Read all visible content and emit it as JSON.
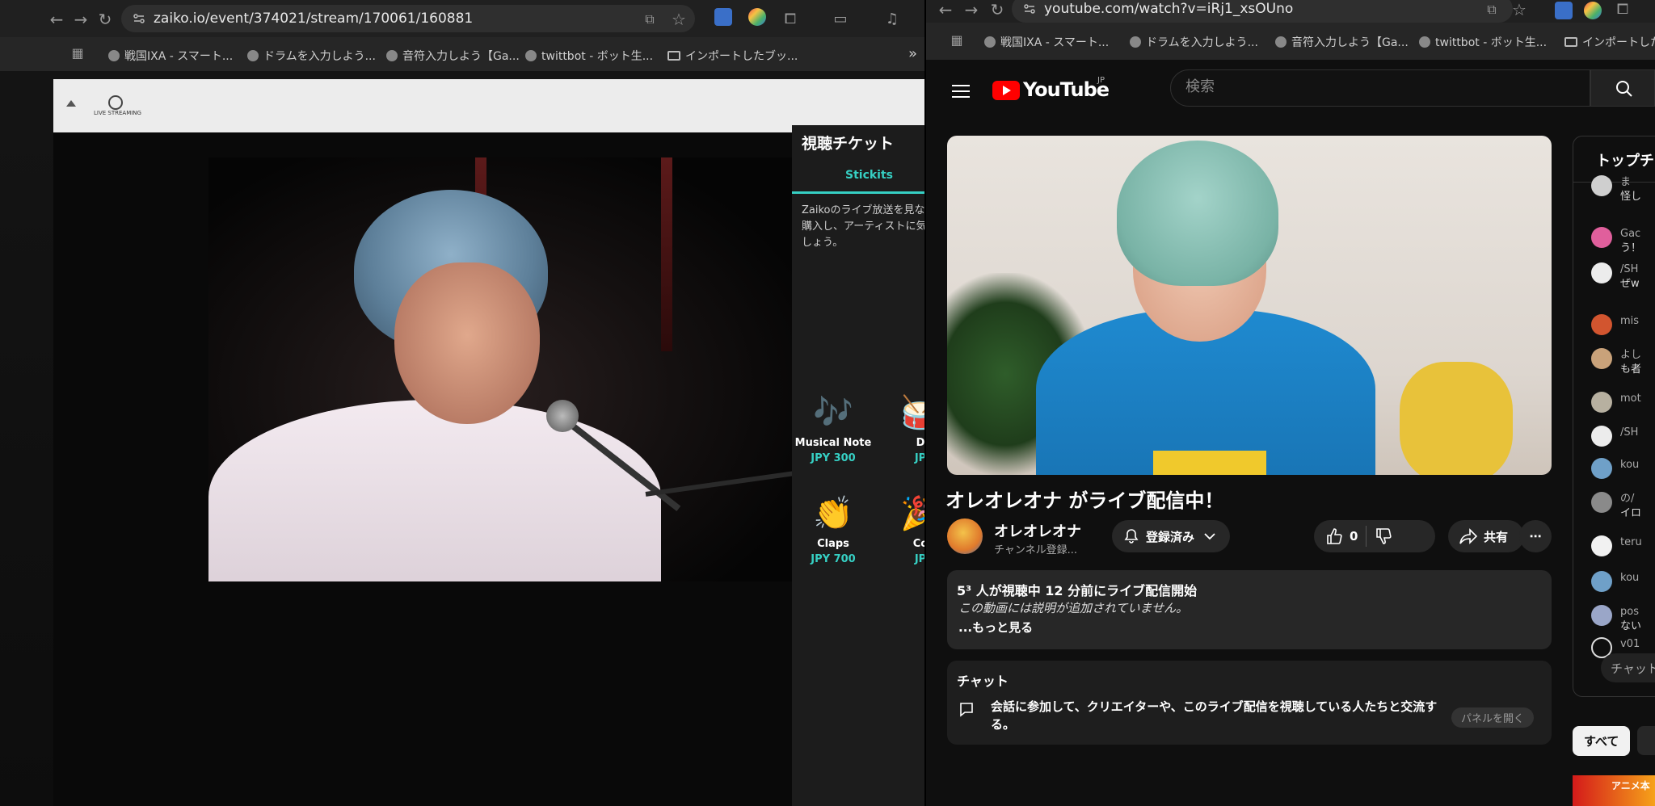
{
  "left_browser": {
    "url": "zaiko.io/event/374021/stream/170061/160881",
    "bookmarks": [
      "戦国IXA - スマート...",
      "ドラムを入力しよう...",
      "音符入力しよう【Ga...",
      "twittbot - ボット生...",
      "インポートしたブッ..."
    ],
    "bookmarks_more": "»",
    "zaiko_logo": "LIVE STREAMING",
    "tickets": {
      "title": "視聴チケット",
      "tab": "Stickits",
      "description": "Zaikoのライブ放送を見ながらStickitsを購入し、アーティストに気持ちを伝えましょう。",
      "items": [
        {
          "emoji": "🎶",
          "name": "Musical Note",
          "price": "JPY 300"
        },
        {
          "emoji": "🥁",
          "name": "D",
          "price": "JP"
        },
        {
          "emoji": "👏",
          "name": "Claps",
          "price": "JPY 700"
        },
        {
          "emoji": "🎉",
          "name": "Co",
          "price": "JP"
        }
      ]
    }
  },
  "right_browser": {
    "url": "youtube.com/watch?v=iRj1_xsOUno",
    "bookmarks": [
      "戦国IXA - スマート...",
      "ドラムを入力しよう...",
      "音符入力しよう【Ga...",
      "twittbot - ボット生...",
      "インポートしたブ"
    ],
    "header": {
      "logo_text": "YouTube",
      "region": "JP",
      "search_placeholder": "検索"
    },
    "video": {
      "title": "オレオレオナ がライブ配信中！",
      "channel": "オレオレオナ",
      "subscribers": "チャンネル登録...",
      "subscribe_label": "登録済み",
      "likes": "0",
      "share_label": "共有",
      "more_label": "⋯"
    },
    "description": {
      "stats": "5³ 人が視聴中  12 分前にライブ配信開始",
      "empty": "この動画には説明が追加されていません。",
      "more": "...もっと見る"
    },
    "chat_box": {
      "header": "チャット",
      "body": "会話に参加して、クリエイターや、このライブ配信を視聴している人たちと交流する。",
      "open_button": "パネルを開く"
    },
    "top_chat": {
      "header": "トップチ",
      "messages": [
        {
          "user": "ま",
          "text": "怪し",
          "color": "#cfcfcf"
        },
        {
          "user": "Gac",
          "text": "う！",
          "color": "#e05f9c"
        },
        {
          "user": "/SH",
          "text": "ぜw",
          "color": "#ececec"
        },
        {
          "user": "mis",
          "text": "",
          "color": "#d2552f"
        },
        {
          "user": "よし",
          "text": "も者",
          "color": "#c9a27a"
        },
        {
          "user": "mot",
          "text": "",
          "color": "#b7b0a0"
        },
        {
          "user": "/SH",
          "text": "",
          "color": "#ececec"
        },
        {
          "user": "kou",
          "text": "",
          "color": "#6fa0c8"
        },
        {
          "user": "の/",
          "text": "イロ",
          "color": "#8a8a8a"
        },
        {
          "user": "teru",
          "text": "",
          "color": "#f1f1f1"
        },
        {
          "user": "kou",
          "text": "",
          "color": "#6fa0c8"
        },
        {
          "user": "pos",
          "text": "ない",
          "color": "#9aa6c8"
        },
        {
          "user": "v01",
          "text": "",
          "color": "#0f0f0f"
        }
      ],
      "input_placeholder": "チャット"
    },
    "chips": {
      "all": "すべて"
    },
    "next_video": "アニメ本"
  }
}
